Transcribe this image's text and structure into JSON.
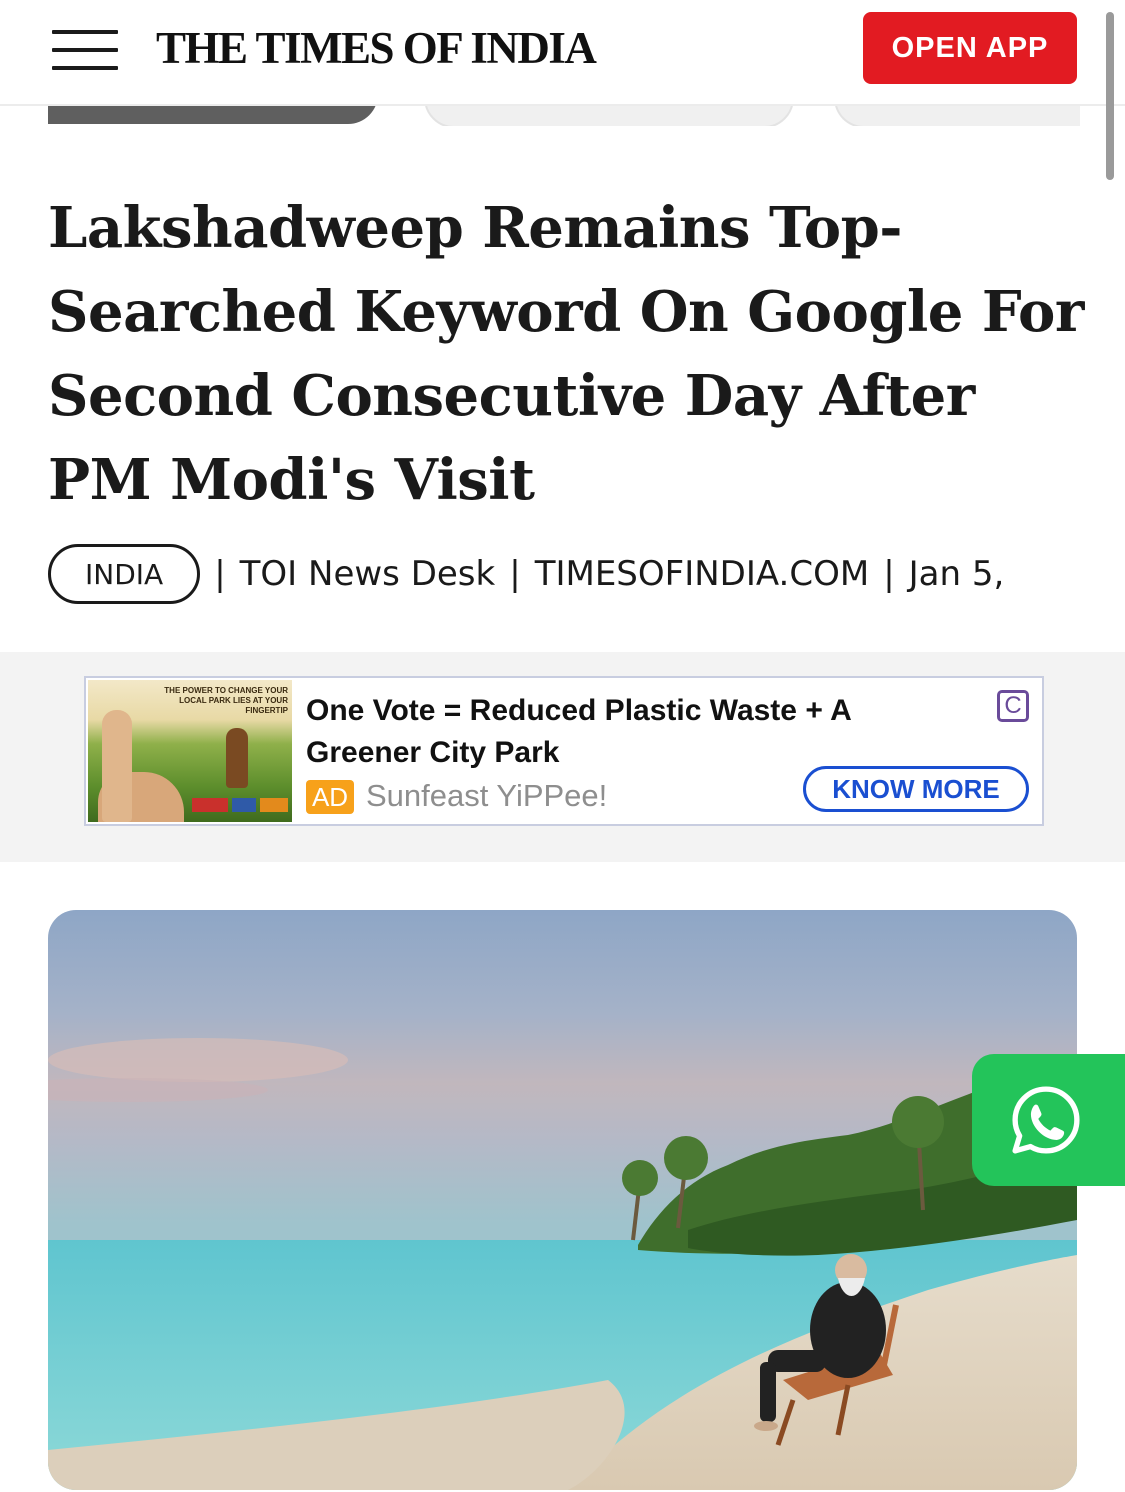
{
  "header": {
    "logo": "THE TIMES OF INDIA",
    "open_app_label": "OPEN APP"
  },
  "article": {
    "headline": "Lakshadweep Remains Top-Searched Keyword On Google For Second Consecutive Day After PM Modi's Visit",
    "category": "INDIA",
    "author": "TOI News Desk",
    "source": "TIMESOFINDIA.COM",
    "date_visible": "Jan 5,"
  },
  "ad": {
    "thumbnail_text": "THE POWER TO CHANGE YOUR LOCAL PARK LIES AT YOUR FINGERTIP",
    "title": "One Vote = Reduced Plastic Waste + A Greener City Park",
    "label": "AD",
    "sponsor": "Sunfeast YiPPee!",
    "cta_label": "KNOW MORE",
    "adchoices_glyph": "C"
  },
  "icons": {
    "menu": "hamburger-menu-icon",
    "whatsapp": "whatsapp-icon",
    "adchoices": "adchoices-icon"
  },
  "colors": {
    "brand_red": "#e21b22",
    "cta_blue": "#1a4fd1",
    "ad_label_orange": "#f7a11a",
    "whatsapp_green": "#23c45a"
  }
}
